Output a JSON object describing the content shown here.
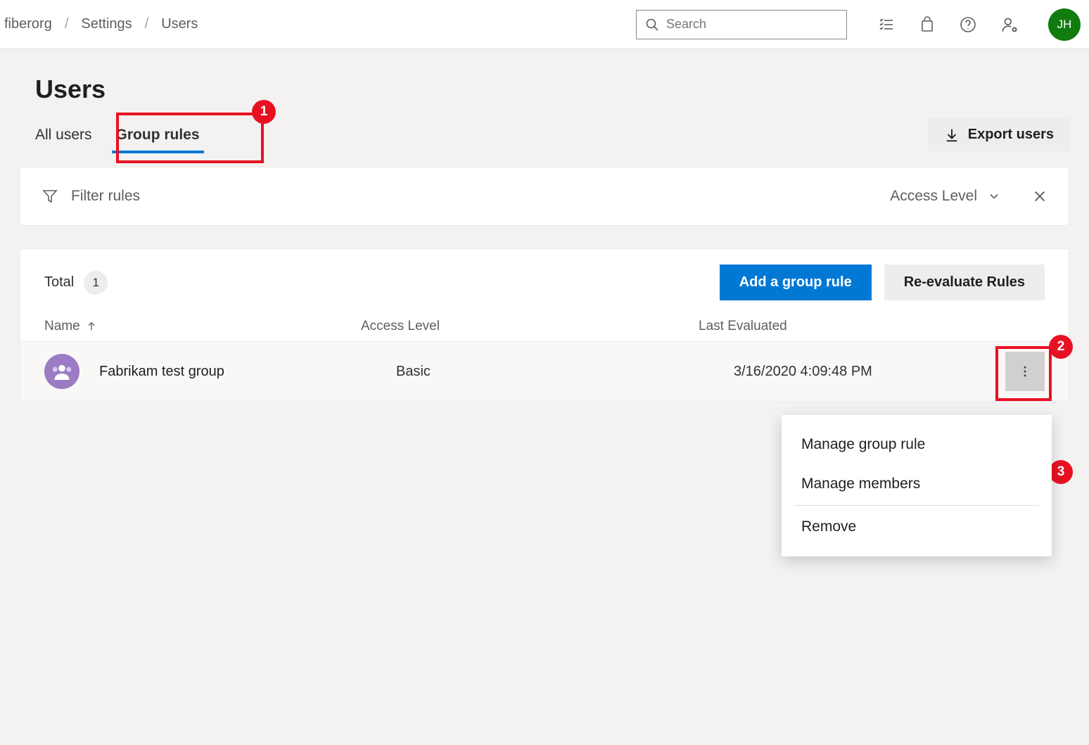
{
  "breadcrumb": {
    "org": "fiberorg",
    "settings": "Settings",
    "users": "Users"
  },
  "search": {
    "placeholder": "Search"
  },
  "avatar": {
    "initials": "JH"
  },
  "page": {
    "title": "Users"
  },
  "tabs": {
    "all_users": "All users",
    "group_rules": "Group rules"
  },
  "export": {
    "label": "Export users"
  },
  "filter": {
    "placeholder": "Filter rules",
    "access_level": "Access Level"
  },
  "card": {
    "total_label": "Total",
    "total_count": "1",
    "add_rule": "Add a group rule",
    "reeval": "Re-evaluate Rules"
  },
  "columns": {
    "name": "Name",
    "access": "Access Level",
    "eval": "Last Evaluated"
  },
  "row": {
    "name": "Fabrikam test group",
    "access": "Basic",
    "eval": "3/16/2020 4:09:48 PM"
  },
  "menu": {
    "manage_rule": "Manage group rule",
    "manage_members": "Manage members",
    "remove": "Remove"
  },
  "callouts": {
    "c1": "1",
    "c2": "2",
    "c3": "3"
  }
}
